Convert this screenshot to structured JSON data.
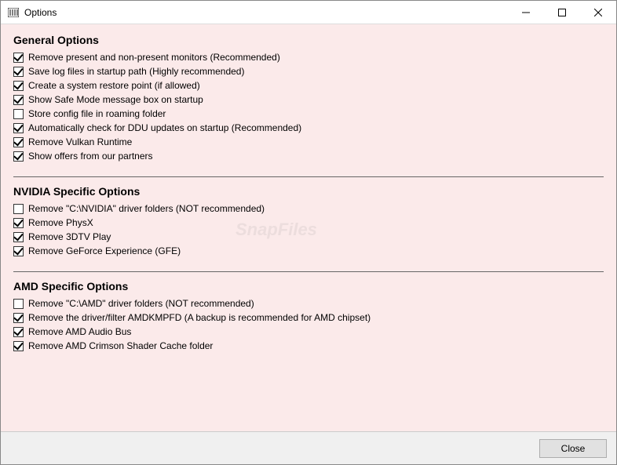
{
  "window": {
    "title": "Options",
    "close_label": "Close"
  },
  "watermark": "SnapFiles",
  "sections": [
    {
      "title": "General Options",
      "options": [
        {
          "checked": true,
          "label": "Remove present and non-present monitors (Recommended)"
        },
        {
          "checked": true,
          "label": "Save log files in startup path (Highly recommended)"
        },
        {
          "checked": true,
          "label": "Create a system restore point (if allowed)"
        },
        {
          "checked": true,
          "label": "Show Safe Mode message box on startup"
        },
        {
          "checked": false,
          "label": "Store config file in roaming folder"
        },
        {
          "checked": true,
          "label": "Automatically check for DDU updates on startup (Recommended)"
        },
        {
          "checked": true,
          "label": "Remove Vulkan Runtime"
        },
        {
          "checked": true,
          "label": "Show offers from our partners"
        }
      ]
    },
    {
      "title": "NVIDIA Specific Options",
      "options": [
        {
          "checked": false,
          "label": "Remove \"C:\\NVIDIA\" driver folders (NOT recommended)"
        },
        {
          "checked": true,
          "label": "Remove PhysX"
        },
        {
          "checked": true,
          "label": "Remove 3DTV Play"
        },
        {
          "checked": true,
          "label": "Remove GeForce Experience (GFE)"
        }
      ]
    },
    {
      "title": "AMD Specific Options",
      "options": [
        {
          "checked": false,
          "label": "Remove \"C:\\AMD\" driver folders (NOT recommended)"
        },
        {
          "checked": true,
          "label": "Remove the driver/filter AMDKMPFD (A backup is recommended for AMD chipset)"
        },
        {
          "checked": true,
          "label": "Remove AMD Audio Bus"
        },
        {
          "checked": true,
          "label": "Remove AMD Crimson Shader Cache folder"
        }
      ]
    }
  ]
}
